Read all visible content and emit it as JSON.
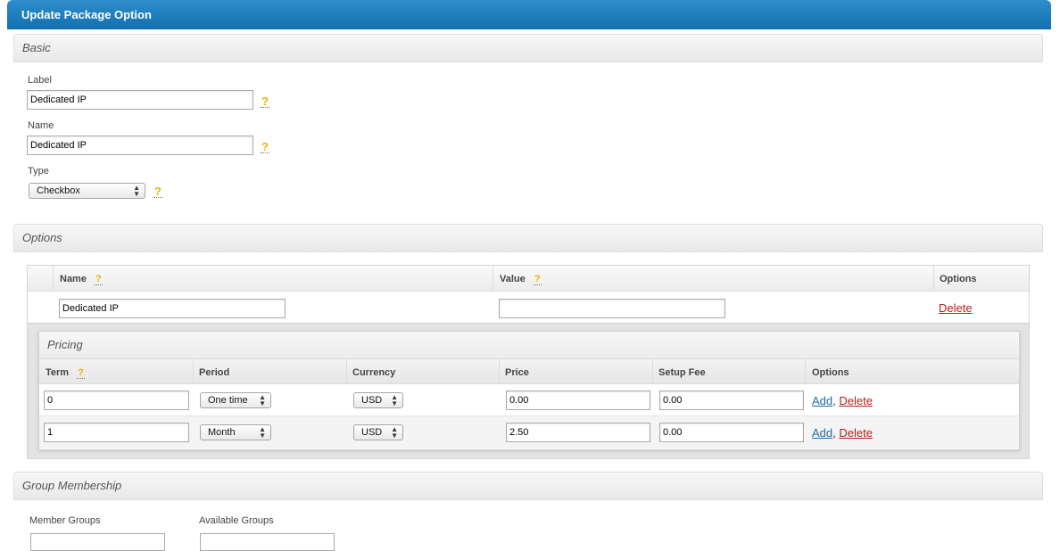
{
  "window": {
    "title": "Update Package Option"
  },
  "basic": {
    "heading": "Basic",
    "label_label": "Label",
    "label_value": "Dedicated IP",
    "name_label": "Name",
    "name_value": "Dedicated IP",
    "type_label": "Type",
    "type_value": "Checkbox",
    "help_glyph": "?"
  },
  "options": {
    "heading": "Options",
    "columns": {
      "name": "Name",
      "value": "Value",
      "options": "Options"
    },
    "row": {
      "name_value": "Dedicated IP",
      "value_value": "",
      "delete_label": "Delete"
    }
  },
  "pricing": {
    "heading": "Pricing",
    "columns": {
      "term": "Term",
      "period": "Period",
      "currency": "Currency",
      "price": "Price",
      "setup_fee": "Setup Fee",
      "options": "Options"
    },
    "rows": [
      {
        "term": "0",
        "period": "One time",
        "currency": "USD",
        "price": "0.00",
        "setup_fee": "0.00",
        "add_label": "Add",
        "sep": ",",
        "delete_label": "Delete"
      },
      {
        "term": "1",
        "period": "Month",
        "currency": "USD",
        "price": "2.50",
        "setup_fee": "0.00",
        "add_label": "Add",
        "sep": ",",
        "delete_label": "Delete"
      }
    ]
  },
  "group_membership": {
    "heading": "Group Membership",
    "member_label": "Member Groups",
    "available_label": "Available Groups"
  },
  "colors": {
    "title_bar": "#1a7ab9",
    "help": "#e2b700",
    "delete_link": "#c11a1a",
    "add_link": "#1a6cb0"
  },
  "icons": {
    "help": "question-mark-icon",
    "select_arrows": "updown-arrows-icon"
  }
}
